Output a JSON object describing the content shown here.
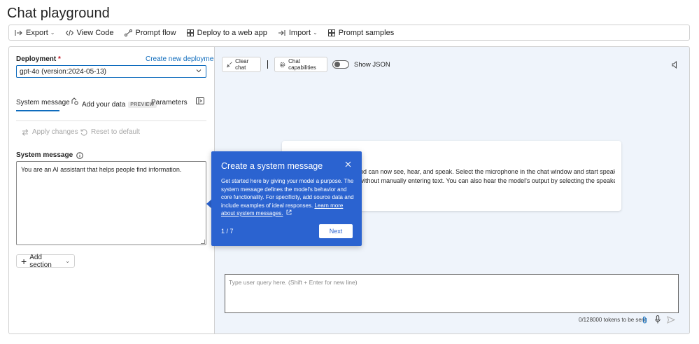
{
  "page": {
    "title": "Chat playground"
  },
  "toolbar": {
    "export": "Export",
    "view_code": "View Code",
    "prompt_flow": "Prompt flow",
    "deploy": "Deploy to a web app",
    "import": "Import",
    "prompt_samples": "Prompt samples"
  },
  "setup": {
    "deployment_label": "Deployment",
    "required_mark": "*",
    "create_link": "Create new deployment",
    "deployment_value": "gpt-4o (version:2024-05-13)",
    "tabs": {
      "system_message": "System message",
      "add_data": "Add your data",
      "preview_badge": "PREVIEW",
      "parameters": "Parameters"
    },
    "apply_changes": "Apply changes",
    "reset_default": "Reset to default",
    "system_message_label": "System message",
    "system_message_value": "You are an AI assistant that helps people find information.",
    "add_section": "Add section"
  },
  "chat": {
    "clear_chat": "Clear chat",
    "chat_capabilities": "Chat capabilities",
    "show_json": "Show JSON",
    "card_line1": "und can now see, hear, and speak. Select the microphone in the chat window and start speaking to",
    "card_line2": "l without manually entering text. You can also hear the model's output by selecting the speaker",
    "query_placeholder": "Type user query here. (Shift + Enter for new line)",
    "tokens_text": "0/128000 tokens to be sent"
  },
  "popover": {
    "title": "Create a system message",
    "body": "Get started here by giving your model a purpose. The system message defines the model's behavior and core functionality. For specificity, add source data and include examples of ideal responses.",
    "link": "Learn more about system messages.",
    "step": "1 / 7",
    "next": "Next"
  },
  "colors": {
    "accent": "#0f6cbd",
    "popover_bg": "#2b63d0",
    "chat_bg": "#eff4fb"
  }
}
